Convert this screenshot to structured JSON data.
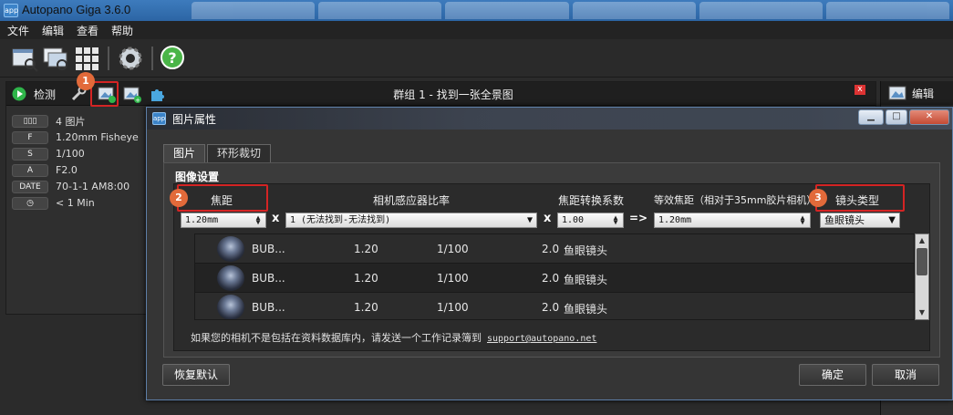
{
  "window": {
    "title": "Autopano Giga 3.6.0",
    "app_icon_text": "app"
  },
  "menu": [
    "文件",
    "编辑",
    "查看",
    "帮助"
  ],
  "toolbar": {
    "buttons": [
      "open-folder-icon",
      "search-images-icon",
      "grid-detect-icon",
      "settings-gear-icon",
      "help-icon"
    ]
  },
  "panel": {
    "detect_label": "检测",
    "title": "群组 1 - 找到一张全景图",
    "close": "x",
    "info": [
      {
        "badge": "▯▯▯",
        "value": "4 图片"
      },
      {
        "badge": "F",
        "value": "1.20mm Fisheye"
      },
      {
        "badge": "S",
        "value": "1/100"
      },
      {
        "badge": "A",
        "value": "F2.0"
      },
      {
        "badge": "DATE",
        "value": "70-1-1 AM8:00"
      },
      {
        "badge": "◷",
        "value": "< 1 Min"
      }
    ]
  },
  "right_panel": {
    "edit_label": "编辑"
  },
  "dialog": {
    "title": "图片属性",
    "title_icon": "app",
    "tabs": [
      "图片",
      "环形裁切"
    ],
    "group_title": "图像设置",
    "headers": {
      "focal": "焦距",
      "sensor": "相机感应器比率",
      "factor": "焦距转换系数",
      "equiv": "等效焦距（相对于35mm胶片相机）",
      "lens": "镜头类型"
    },
    "fields": {
      "focal": "1.20mm",
      "sensor": "1 (无法找到-无法找到)",
      "factor": "1.00",
      "equiv": "1.20mm",
      "lens": "鱼眼镜头"
    },
    "ops": {
      "x1": "x",
      "x2": "x",
      "arrow": "=>"
    },
    "rows": [
      {
        "name": "BUB...",
        "focal": "1.20",
        "shutter": "1/100",
        "aperture": "2.0",
        "lens": "鱼眼镜头"
      },
      {
        "name": "BUB...",
        "focal": "1.20",
        "shutter": "1/100",
        "aperture": "2.0",
        "lens": "鱼眼镜头"
      },
      {
        "name": "BUB...",
        "focal": "1.20",
        "shutter": "1/100",
        "aperture": "2.0",
        "lens": "鱼眼镜头"
      }
    ],
    "note": "如果您的相机不是包括在资料数据库内，请发送一个工作记录簿到",
    "note_link": "support@autopano.net",
    "buttons": {
      "reset": "恢复默认",
      "ok": "确定",
      "cancel": "取消"
    },
    "win_buttons": [
      "▁",
      "□",
      "✕"
    ]
  },
  "steps": [
    "1",
    "2",
    "3"
  ],
  "colors": {
    "highlight": "#d42424",
    "step_badge": "#e26a3a",
    "play": "#2fb54a",
    "puzzle": "#4aa7e0"
  }
}
